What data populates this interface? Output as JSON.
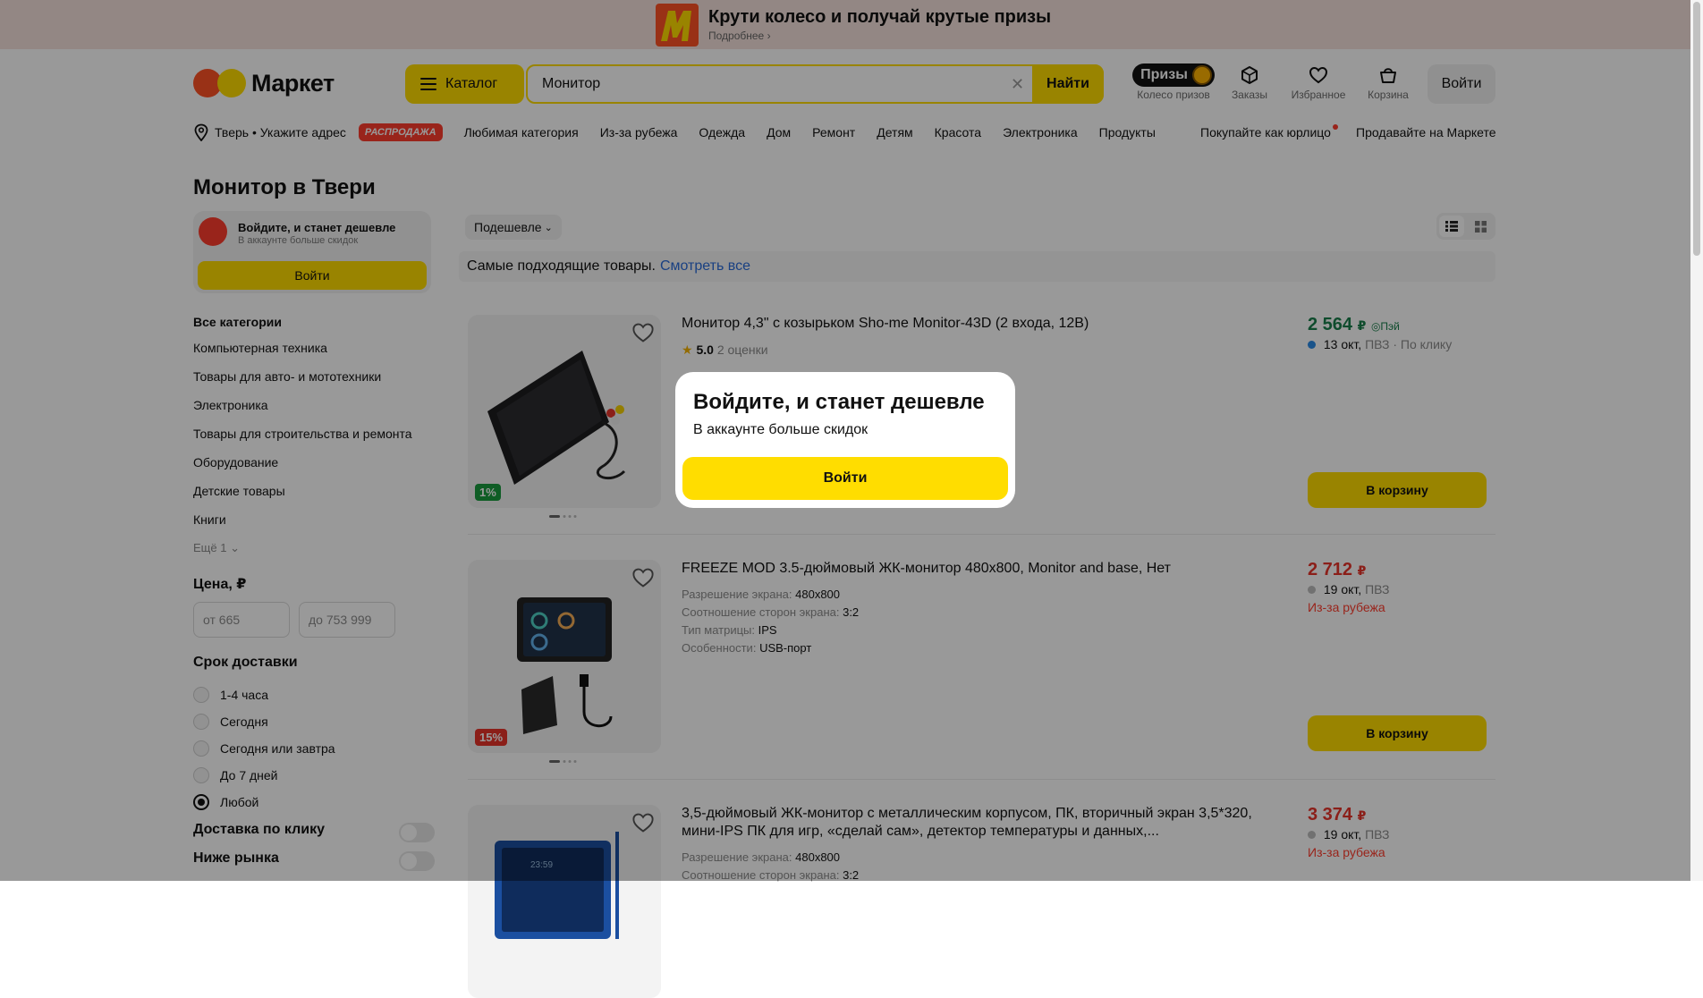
{
  "promo_banner": {
    "title": "Крути колесо и получай крутые призы",
    "subtitle": "Подробнее ›"
  },
  "header": {
    "logo_text": "Маркет",
    "catalog_label": "Каталог",
    "search": {
      "value": "Монитор",
      "button_label": "Найти"
    },
    "prizes_label": "Призы",
    "icons": [
      {
        "label": "Колесо призов",
        "icon": "prize-wheel-icon"
      },
      {
        "label": "Заказы",
        "icon": "box-icon"
      },
      {
        "label": "Избранное",
        "icon": "heart-icon"
      },
      {
        "label": "Корзина",
        "icon": "cart-icon"
      }
    ],
    "login_label": "Войти"
  },
  "nav": {
    "location": "Тверь • Укажите адрес",
    "sale_badge": "РАСПРОДАЖА",
    "items": [
      "Любимая категория",
      "Из-за рубежа",
      "Одежда",
      "Дом",
      "Ремонт",
      "Детям",
      "Красота",
      "Электроника",
      "Продукты"
    ],
    "right_items": [
      "Покупайте как юрлицо",
      "Продавайте на Маркете"
    ]
  },
  "page": {
    "title": "Монитор в Твери"
  },
  "sidebar": {
    "promo": {
      "title": "Войдите, и станет дешевле",
      "subtitle": "В аккаунте больше скидок",
      "button": "Войти"
    },
    "categories_header": "Все категории",
    "categories": [
      "Компьютерная техника",
      "Товары для авто- и мототехники",
      "Электроника",
      "Товары для строительства и ремонта",
      "Оборудование",
      "Детские товары",
      "Книги"
    ],
    "more_label": "Ещё 1",
    "price": {
      "header": "Цена, ₽",
      "from_placeholder": "от 665",
      "to_placeholder": "до 753 999"
    },
    "delivery": {
      "header": "Срок доставки",
      "options": [
        "1-4 часа",
        "Сегодня",
        "Сегодня или завтра",
        "До 7 дней",
        "Любой"
      ],
      "selected": "Любой"
    },
    "toggles": [
      "Доставка по клику",
      "Ниже рынка"
    ]
  },
  "listing": {
    "sort_label": "Подешевле",
    "best_text": "Самые подходящие товары.",
    "best_link": "Смотреть все",
    "products": [
      {
        "title": "Монитор 4,3\" с козырьком Sho-me Monitor-43D (2 входа, 12В)",
        "rating": "5.0",
        "reviews": "2 оценки",
        "price": "2 564",
        "currency": "₽",
        "pay_badge": "Пэй",
        "price_color": "#1a7f4b",
        "delivery_date": "13 окт,",
        "delivery_rest": "ПВЗ · По клику",
        "delivery_dot_color": "#2b8ae6",
        "discount": "1%",
        "discount_color": "#1a9b3e",
        "cart_label": "В корзину"
      },
      {
        "title": "FREEZE MOD 3.5-дюймовый ЖК-монитор 480x800, Monitor and base, Нет",
        "specs": [
          {
            "k": "Разрешение экрана:",
            "v": "480x800"
          },
          {
            "k": "Соотношение сторон экрана:",
            "v": "3:2"
          },
          {
            "k": "Тип матрицы:",
            "v": "IPS"
          },
          {
            "k": "Особенности:",
            "v": "USB-порт"
          }
        ],
        "price": "2 712",
        "currency": "₽",
        "price_color": "#e8342b",
        "delivery_date": "19 окт,",
        "delivery_rest": "ПВЗ",
        "delivery_dot_color": "#bdbdbd",
        "abroad": "Из-за рубежа",
        "discount": "15%",
        "discount_color": "#e8342b",
        "cart_label": "В корзину"
      },
      {
        "title": "3,5-дюймовый ЖК-монитор с металлическим корпусом, ПК, вторичный экран 3,5*320, мини-IPS ПК для игр, «сделай сам», детектор температуры и данных,...",
        "specs": [
          {
            "k": "Разрешение экрана:",
            "v": "480x800"
          },
          {
            "k": "Соотношение сторон экрана:",
            "v": "3:2"
          }
        ],
        "price": "3 374",
        "currency": "₽",
        "price_color": "#e8342b",
        "delivery_date": "19 окт,",
        "delivery_rest": "ПВЗ",
        "delivery_dot_color": "#bdbdbd",
        "abroad": "Из-за рубежа"
      }
    ]
  },
  "popup": {
    "title": "Войдите, и станет дешевле",
    "subtitle": "В аккаунте больше скидок",
    "button": "Войти"
  }
}
